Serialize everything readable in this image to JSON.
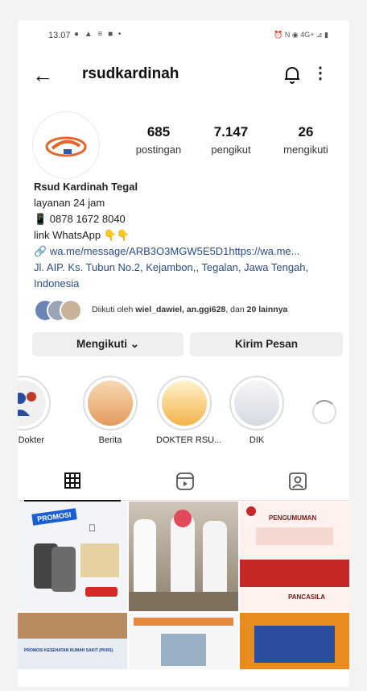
{
  "status_bar": {
    "time": "13.07",
    "left_icons": "● ▲ ≡ ■ •",
    "right_icons": "⏰ N ◉ 4G+ ⊿ ▮"
  },
  "header": {
    "username": "rsudkardinah"
  },
  "stats": {
    "posts": {
      "value": "685",
      "label": "postingan"
    },
    "followers": {
      "value": "7.147",
      "label": "pengikut"
    },
    "following": {
      "value": "26",
      "label": "mengikuti"
    }
  },
  "bio": {
    "name": "Rsud Kardinah Tegal",
    "line1": "layanan 24 jam",
    "phone": "📱 0878 1672 8040",
    "whatsapp": "link WhatsApp 👇👇",
    "link": "wa.me/message/ARB3O3MGW5E5D1https://wa.me...",
    "address": "Jl. AIP. Ks. Tubun No.2, Kejambon,, Tegalan, Jawa Tengah, Indonesia"
  },
  "followed_by": {
    "prefix": "Diikuti oleh ",
    "users": "wiel_dawiel, an.ggi628",
    "suffix": ", dan ",
    "count": "20 lainnya"
  },
  "buttons": {
    "following": "Mengikuti ⌄",
    "message": "Kirim Pesan"
  },
  "highlights": [
    {
      "label": "wal Dokter"
    },
    {
      "label": "Berita"
    },
    {
      "label": "DOKTER RSU..."
    },
    {
      "label": "DIK"
    }
  ],
  "tiles": [
    {
      "caption": "PROMOSI"
    },
    {
      "caption": ""
    },
    {
      "caption": "PENGUMUMAN"
    },
    {
      "caption": "PANCASILA"
    },
    {
      "caption": "PROMOSI KESEHATAN RUMAH SAKIT (PKRS)"
    },
    {
      "caption": ""
    },
    {
      "caption": ""
    }
  ],
  "colors": {
    "accent": "#294b88",
    "brand": "#e2672a"
  }
}
